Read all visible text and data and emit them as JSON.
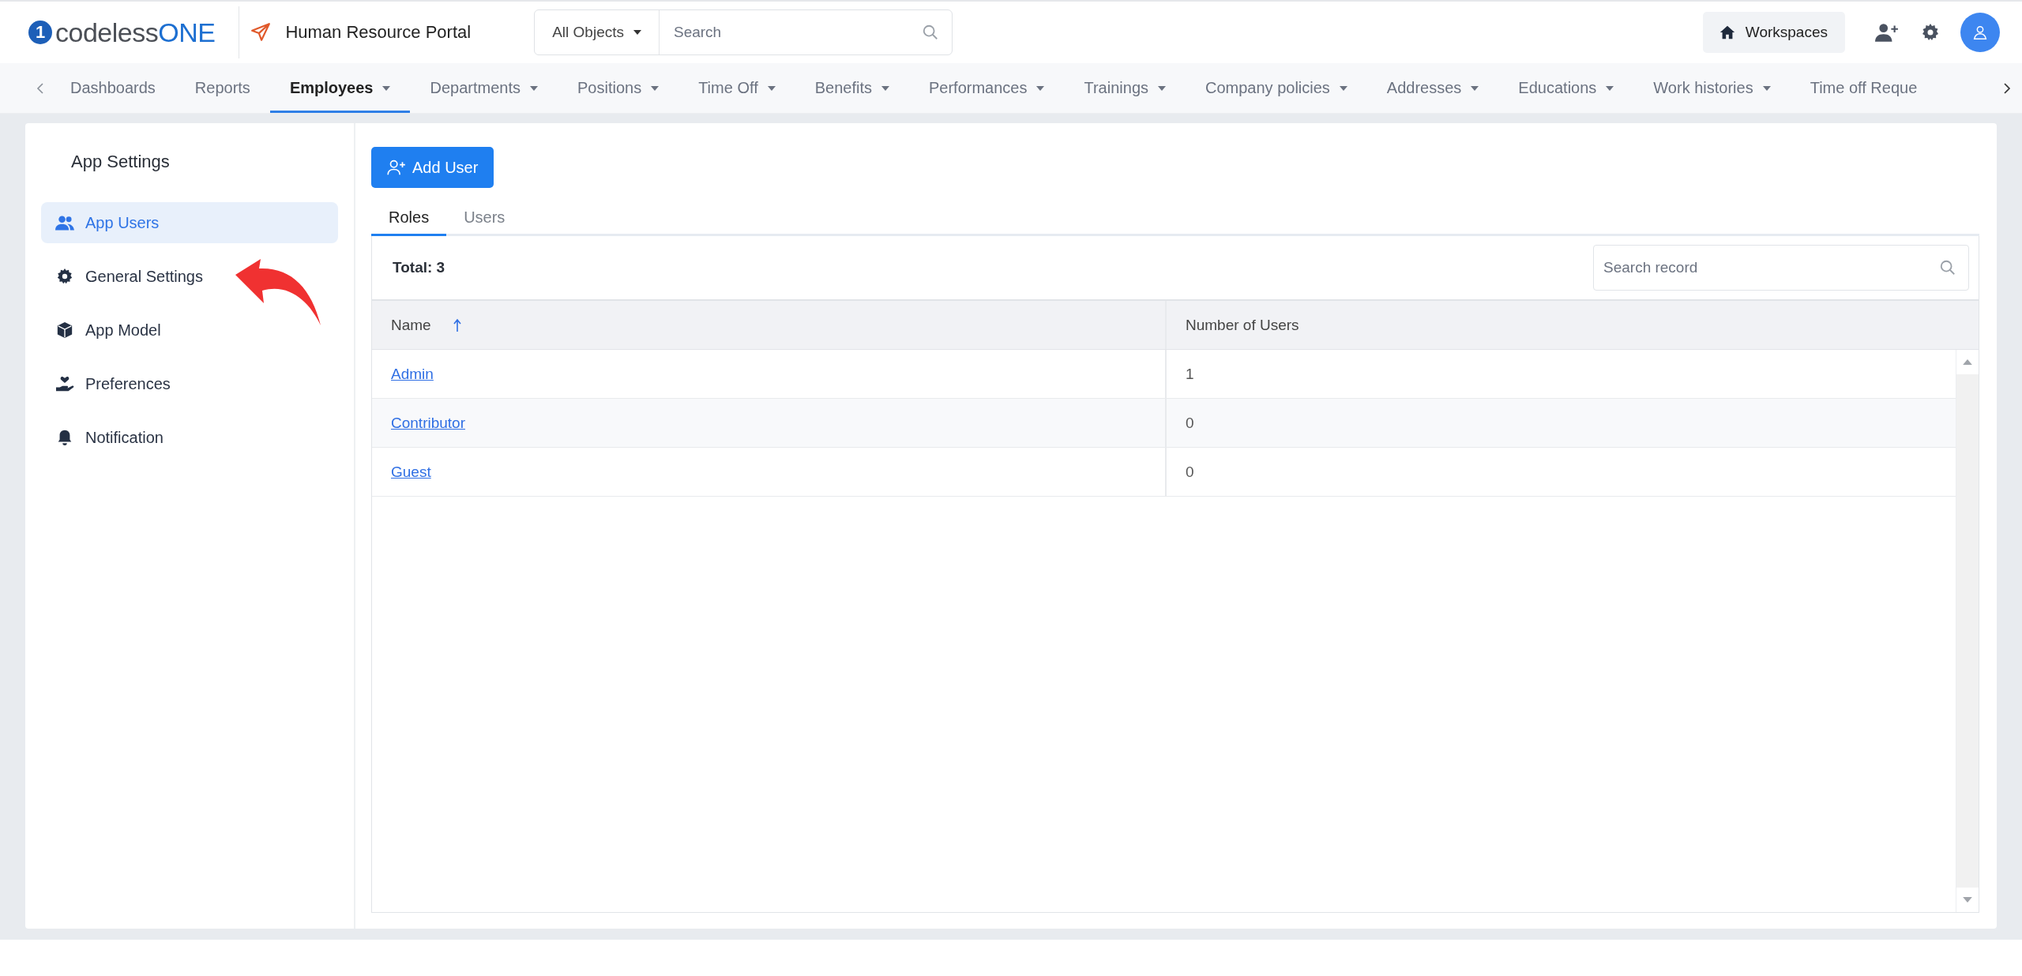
{
  "header": {
    "logo": {
      "mark": "1",
      "text": "codeless",
      "accent": "ONE"
    },
    "app_title": "Human Resource Portal",
    "search": {
      "scope": "All Objects",
      "placeholder": "Search"
    },
    "workspaces": "Workspaces"
  },
  "nav": {
    "items": [
      {
        "label": "Dashboards",
        "dropdown": false,
        "selected": false
      },
      {
        "label": "Reports",
        "dropdown": false,
        "selected": false
      },
      {
        "label": "Employees",
        "dropdown": true,
        "selected": true
      },
      {
        "label": "Departments",
        "dropdown": true,
        "selected": false
      },
      {
        "label": "Positions",
        "dropdown": true,
        "selected": false
      },
      {
        "label": "Time Off",
        "dropdown": true,
        "selected": false
      },
      {
        "label": "Benefits",
        "dropdown": true,
        "selected": false
      },
      {
        "label": "Performances",
        "dropdown": true,
        "selected": false
      },
      {
        "label": "Trainings",
        "dropdown": true,
        "selected": false
      },
      {
        "label": "Company policies",
        "dropdown": true,
        "selected": false
      },
      {
        "label": "Addresses",
        "dropdown": true,
        "selected": false
      },
      {
        "label": "Educations",
        "dropdown": true,
        "selected": false
      },
      {
        "label": "Work histories",
        "dropdown": true,
        "selected": false
      },
      {
        "label": "Time off Reque",
        "dropdown": false,
        "selected": false
      }
    ]
  },
  "sidebar": {
    "title": "App Settings",
    "items": [
      {
        "label": "App Users",
        "kind": "users",
        "selected": true
      },
      {
        "label": "General Settings",
        "kind": "gear",
        "selected": false
      },
      {
        "label": "App Model",
        "kind": "cube",
        "selected": false
      },
      {
        "label": "Preferences",
        "kind": "care",
        "selected": false
      },
      {
        "label": "Notification",
        "kind": "bell",
        "selected": false
      }
    ]
  },
  "content": {
    "add_button": "Add User",
    "tabs": [
      {
        "label": "Roles",
        "selected": true
      },
      {
        "label": "Users",
        "selected": false
      }
    ],
    "table": {
      "total": "Total: 3",
      "search_placeholder": "Search record",
      "columns": [
        {
          "label": "Name",
          "sorted": true
        },
        {
          "label": "Number of Users",
          "sorted": false
        }
      ],
      "rows": [
        [
          "Admin",
          "1"
        ],
        [
          "Contributor",
          "0"
        ],
        [
          "Guest",
          "0"
        ]
      ]
    }
  }
}
